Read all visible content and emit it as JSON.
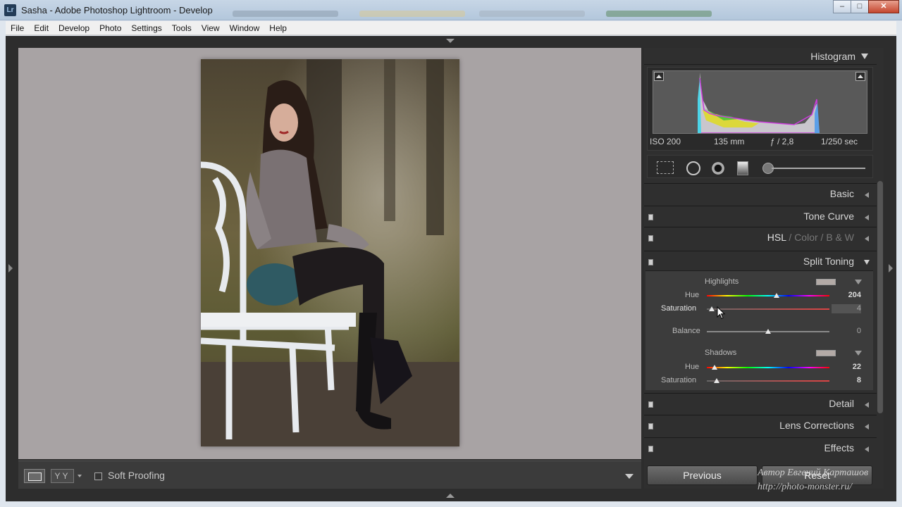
{
  "window": {
    "app_icon": "Lr",
    "title": "Sasha - Adobe Photoshop Lightroom - Develop",
    "controls": {
      "minimize": "–",
      "maximize": "□",
      "close": "✕"
    }
  },
  "menu": [
    "File",
    "Edit",
    "Develop",
    "Photo",
    "Settings",
    "Tools",
    "View",
    "Window",
    "Help"
  ],
  "toolbar": {
    "view_yy": "YY",
    "soft_proofing_label": "Soft Proofing",
    "soft_proofing_checked": false
  },
  "histogram": {
    "title": "Histogram",
    "iso": "ISO 200",
    "focal": "135 mm",
    "aperture": "ƒ / 2,8",
    "shutter": "1/250 sec"
  },
  "panels": {
    "basic": "Basic",
    "tone_curve": "Tone Curve",
    "hsl": "HSL",
    "color": "Color",
    "bw": "B & W",
    "hsl_sep": "/",
    "split_toning": "Split Toning",
    "detail": "Detail",
    "lens_corrections": "Lens Corrections",
    "effects": "Effects"
  },
  "split_toning": {
    "highlights_label": "Highlights",
    "hue_label": "Hue",
    "saturation_label": "Saturation",
    "balance_label": "Balance",
    "shadows_label": "Shadows",
    "highlights_hue": "204",
    "highlights_hue_frac": 0.567,
    "highlights_saturation": "4",
    "highlights_saturation_frac": 0.04,
    "balance": "0",
    "balance_frac": 0.5,
    "shadows_hue": "22",
    "shadows_hue_frac": 0.061,
    "shadows_saturation": "8",
    "shadows_saturation_frac": 0.08,
    "swatch_color": "#b3aaa6"
  },
  "buttons": {
    "previous": "Previous",
    "reset": "Reset"
  },
  "watermark": [
    "Автор Евгений Карташов",
    "http://photo-monster.ru/"
  ],
  "colors": {
    "canvas": "#a8a3a4",
    "panel": "#2f2f2f",
    "titlebar": "#bfd0e2"
  }
}
